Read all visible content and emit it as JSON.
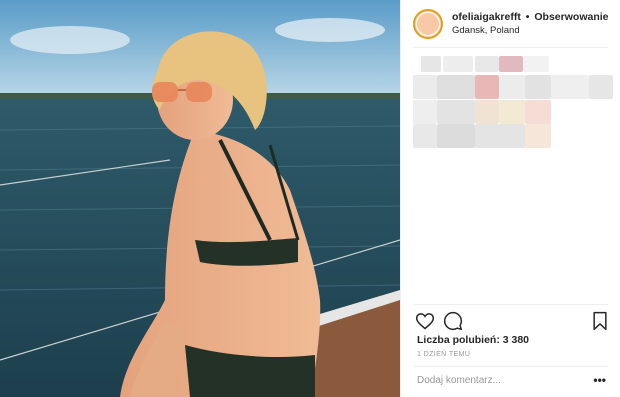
{
  "post": {
    "username": "ofeliaigakrefft",
    "separator": "•",
    "follow_label": "Obserwowanie",
    "location": "Gdansk, Poland",
    "likes_text": "Liczba polubień: 3 380",
    "time_text": "1 DZIEŃ TEMU",
    "comment_placeholder": "Dodaj komentarz...",
    "more_label": "•••"
  },
  "icons": {
    "like": "heart-icon",
    "comment": "comment-icon",
    "save": "bookmark-icon"
  },
  "colors": {
    "avatar_ring": "#e0a020",
    "text": "#262626",
    "muted": "#999999"
  }
}
